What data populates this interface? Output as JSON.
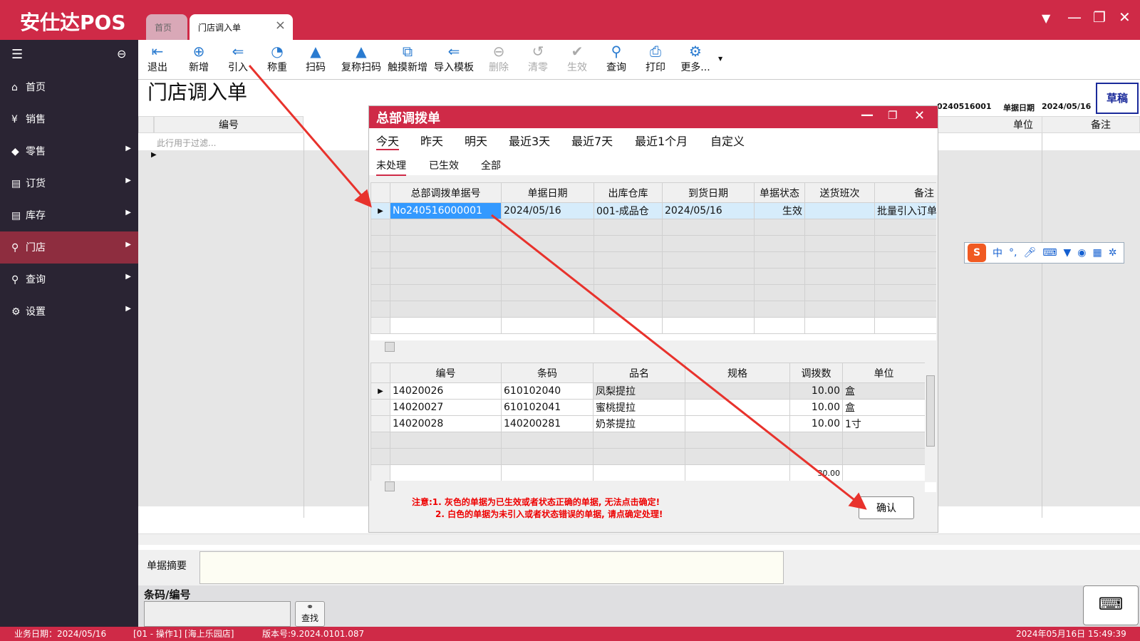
{
  "app": {
    "title": "安仕达POS",
    "tabs": [
      "首页",
      "门店调入单"
    ]
  },
  "sidebar": {
    "items": [
      {
        "label": "首页",
        "icon": "home-icon"
      },
      {
        "label": "销售",
        "icon": "yen-icon"
      },
      {
        "label": "零售",
        "icon": "tag-icon"
      },
      {
        "label": "订货",
        "icon": "database-icon"
      },
      {
        "label": "库存",
        "icon": "database-icon"
      },
      {
        "label": "门店",
        "icon": "search-icon",
        "active": true
      },
      {
        "label": "查询",
        "icon": "search-icon"
      },
      {
        "label": "设置",
        "icon": "gear-icon"
      }
    ]
  },
  "toolbar": {
    "items": [
      {
        "label": "退出",
        "enabled": true
      },
      {
        "label": "新增",
        "enabled": true
      },
      {
        "label": "引入",
        "enabled": true
      },
      {
        "label": "称重",
        "enabled": true
      },
      {
        "label": "扫码",
        "enabled": true
      },
      {
        "label": "复称扫码",
        "enabled": true
      },
      {
        "label": "触摸新增",
        "enabled": true
      },
      {
        "label": "导入模板",
        "enabled": true
      },
      {
        "label": "删除",
        "enabled": false
      },
      {
        "label": "清零",
        "enabled": false
      },
      {
        "label": "生效",
        "enabled": false
      },
      {
        "label": "查询",
        "enabled": true
      },
      {
        "label": "打印",
        "enabled": true
      },
      {
        "label": "更多...",
        "enabled": true
      }
    ]
  },
  "page": {
    "title": "门店调入单",
    "doc_no_fragment": "0240516001",
    "doc_date_label": "单据日期",
    "doc_date": "2024/05/16",
    "status_badge": "草稿",
    "grid_headers": [
      "编号",
      "单位",
      "备注"
    ],
    "filter_placeholder": "此行用于过滤...",
    "summary_label": "单据摘要",
    "barcode_label": "条码/编号",
    "find_label": "查找"
  },
  "dialog": {
    "title": "总部调拨单",
    "date_tabs": [
      "今天",
      "昨天",
      "明天",
      "最近3天",
      "最近7天",
      "最近1个月",
      "自定义"
    ],
    "status_tabs": [
      "未处理",
      "已生效",
      "全部"
    ],
    "upper_headers": [
      "总部调拨单据号",
      "单据日期",
      "出库仓库",
      "到货日期",
      "单据状态",
      "送货班次",
      "备注"
    ],
    "upper_rows": [
      [
        "No240516000001",
        "2024/05/16",
        "001-成品仓",
        "2024/05/16",
        "生效",
        "",
        "批量引入订单"
      ]
    ],
    "lower_headers": [
      "编号",
      "条码",
      "品名",
      "规格",
      "调拨数",
      "单位"
    ],
    "lower_rows": [
      [
        "14020026",
        "610102040",
        "凤梨提拉",
        "",
        "10.00",
        "盒"
      ],
      [
        "14020027",
        "610102041",
        "蜜桃提拉",
        "",
        "10.00",
        "盒"
      ],
      [
        "14020028",
        "140200281",
        "奶茶提拉",
        "",
        "10.00",
        "1寸"
      ]
    ],
    "lower_total": "30.00",
    "notice_1": "注意:1. 灰色的单据为已生效或者状态正确的单据, 无法点击确定!",
    "notice_2": "2. 白色的单据为未引入或者状态错误的单据, 请点确定处理!",
    "confirm_label": "确认"
  },
  "ime": {
    "items": [
      "中",
      "°,"
    ]
  },
  "statusbar": {
    "business_date": "业务日期：2024/05/16",
    "operator": "[01 - 操作1]  [海上乐园店]",
    "version": "版本号:9.2024.0101.087",
    "clock": "2024年05月16日 15:49:39"
  },
  "colors": {
    "brand": "#cf2a47",
    "sidebar": "#2a2433",
    "sidebar_active": "#8e2d3f",
    "selection": "#3399ff",
    "notice": "#ee0000"
  }
}
